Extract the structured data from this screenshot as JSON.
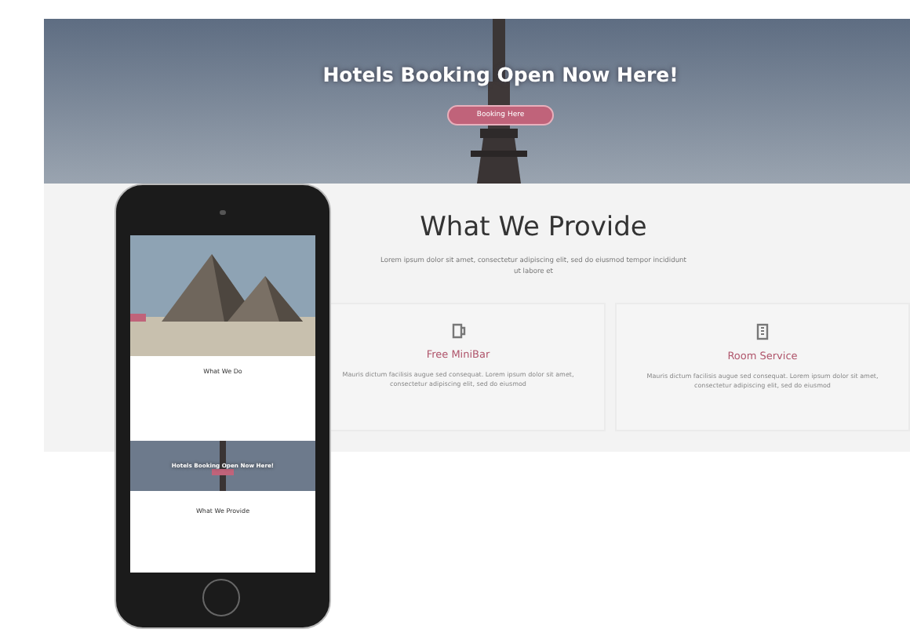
{
  "hero": {
    "title": "Hotels Booking Open Now Here!",
    "button": "Booking Here"
  },
  "provide": {
    "title": "What We Provide",
    "subtitle": "Lorem ipsum dolor sit amet, consectetur adipiscing elit, sed do eiusmod tempor incididunt ut labore et",
    "cards": [
      {
        "kind": "minibar",
        "title": "Free MiniBar",
        "text": "Mauris dictum facilisis augue sed consequat. Lorem ipsum dolor sit amet, consectetur adipiscing elit, sed do eiusmod"
      },
      {
        "kind": "room",
        "title": "Room Service",
        "text": "Mauris dictum facilisis augue sed consequat. Lorem ipsum dolor sit amet, consectetur adipiscing elit, sed do eiusmod"
      }
    ]
  },
  "phone": {
    "about_title": "What We Do",
    "banner_title": "Hotels Booking Open Now Here!",
    "provide_title": "What We Provide"
  }
}
